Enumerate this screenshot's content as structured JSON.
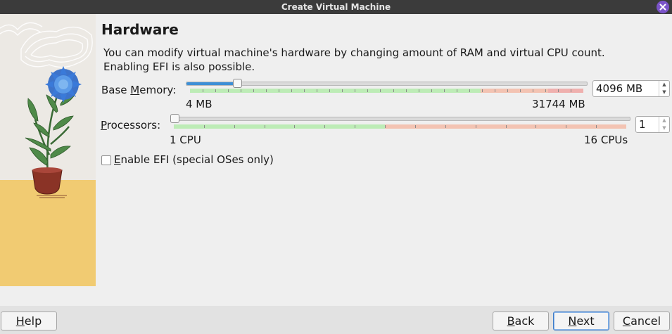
{
  "window": {
    "title": "Create Virtual Machine"
  },
  "page": {
    "heading": "Hardware",
    "description": "You can modify virtual machine's hardware by changing amount of RAM and virtual CPU count. Enabling EFI is also possible."
  },
  "memory": {
    "label_pre": "Base ",
    "label_mnemonic": "M",
    "label_post": "emory:",
    "min_label": "4 MB",
    "max_label": "31744 MB",
    "value": "4096 MB",
    "value_mb": 4096,
    "min_mb": 4,
    "max_mb": 31744
  },
  "processors": {
    "label_mnemonic": "P",
    "label_post": "rocessors:",
    "min_label": "1 CPU",
    "max_label": "16 CPUs",
    "value": "1"
  },
  "efi": {
    "label_mnemonic": "E",
    "label_post": "nable EFI (special OSes only)",
    "checked": false
  },
  "buttons": {
    "help": {
      "mnemonic": "H",
      "rest": "elp"
    },
    "back": {
      "mnemonic": "B",
      "rest": "ack"
    },
    "next": {
      "mnemonic": "N",
      "rest": "ext"
    },
    "cancel": {
      "mnemonic": "C",
      "rest": "ancel"
    }
  },
  "colors": {
    "accent": "#3d8fd6",
    "safe_range": "#bdecb6",
    "warn_range": "#f3c3b2",
    "close_button": "#7b53c9"
  },
  "icons": {
    "close": "close-icon",
    "spin_up": "arrow-up-icon",
    "spin_down": "arrow-down-icon"
  }
}
